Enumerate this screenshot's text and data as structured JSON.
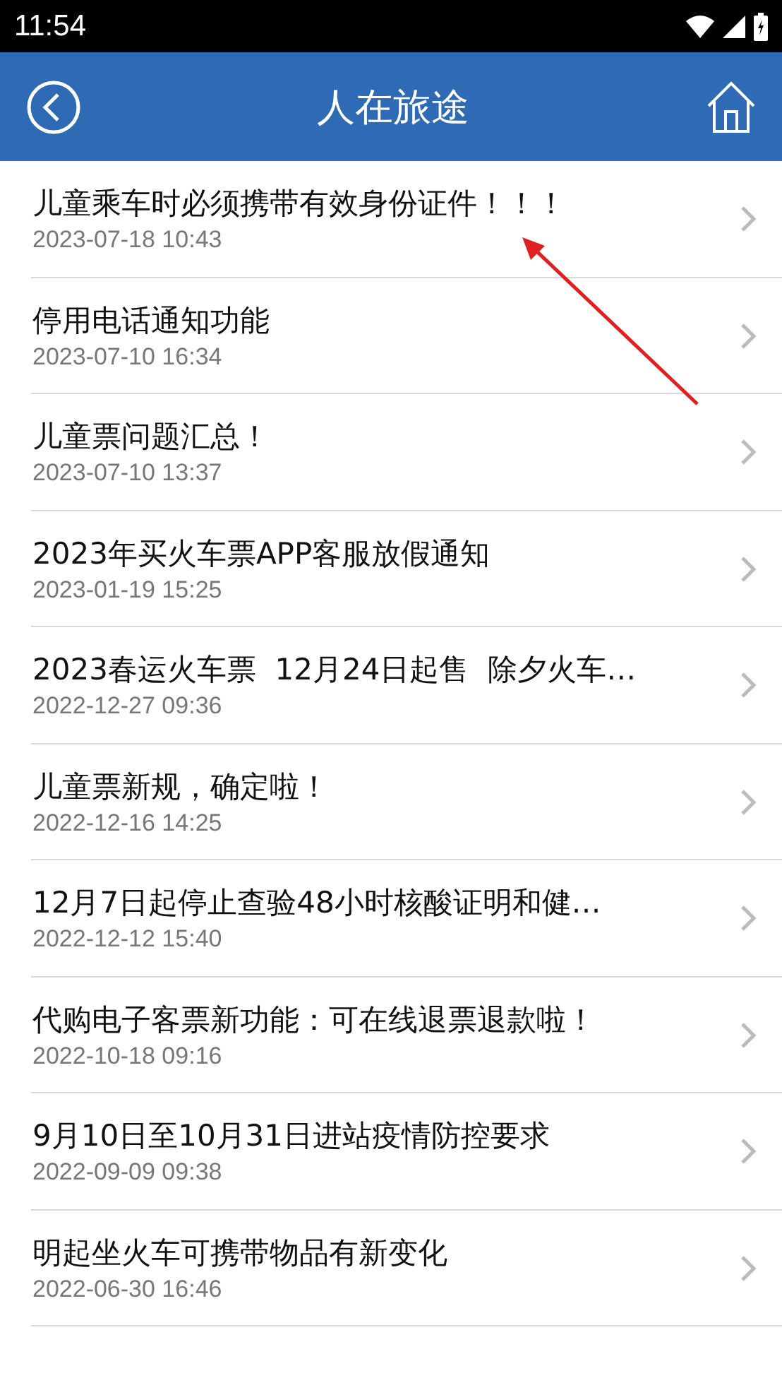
{
  "status_bar": {
    "time": "11:54"
  },
  "header": {
    "title": "人在旅途"
  },
  "news": [
    {
      "title": "儿童乘车时必须携带有效身份证件！！！",
      "date": "2023-07-18 10:43"
    },
    {
      "title": "停用电话通知功能",
      "date": "2023-07-10 16:34"
    },
    {
      "title": "儿童票问题汇总！",
      "date": "2023-07-10 13:37"
    },
    {
      "title": "2023年买火车票APP客服放假通知",
      "date": "2023-01-19 15:25"
    },
    {
      "title": "2023春运火车票  12月24日起售  除夕火车…",
      "date": "2022-12-27 09:36"
    },
    {
      "title": "儿童票新规，确定啦！",
      "date": "2022-12-16 14:25"
    },
    {
      "title": "12月7日起停止查验48小时核酸证明和健…",
      "date": "2022-12-12 15:40"
    },
    {
      "title": "代购电子客票新功能：可在线退票退款啦！",
      "date": "2022-10-18 09:16"
    },
    {
      "title": "9月10日至10月31日进站疫情防控要求",
      "date": "2022-09-09 09:38"
    },
    {
      "title": "明起坐火车可携带物品有新变化",
      "date": "2022-06-30 16:46"
    }
  ]
}
